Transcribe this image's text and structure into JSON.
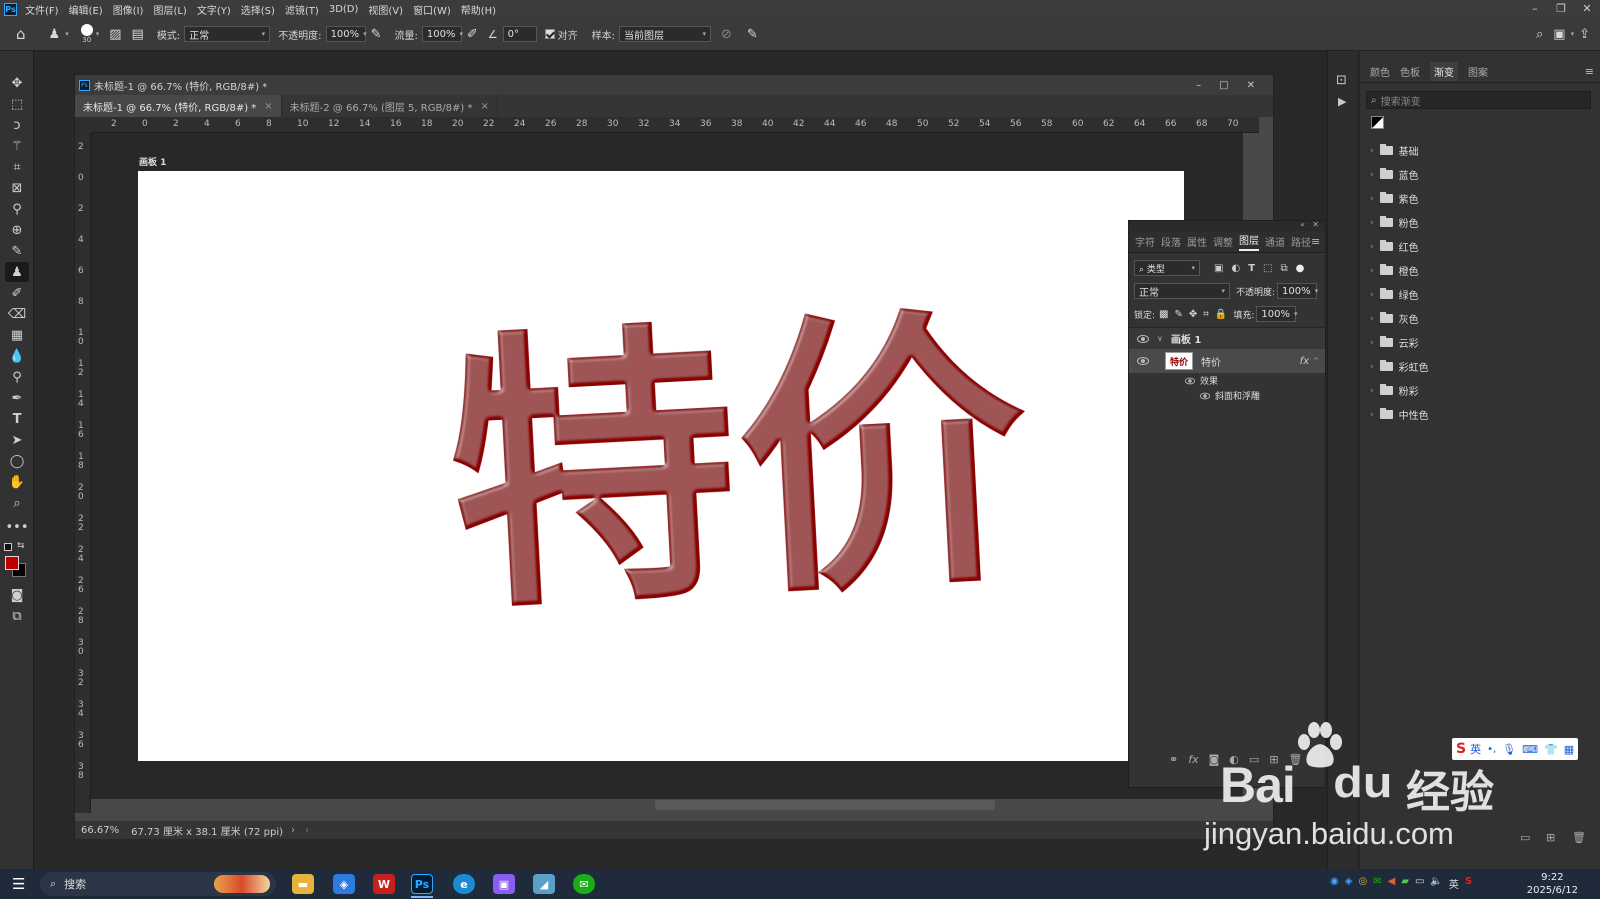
{
  "app": {
    "logo": "Ps"
  },
  "menu": [
    "文件(F)",
    "编辑(E)",
    "图像(I)",
    "图层(L)",
    "文字(Y)",
    "选择(S)",
    "滤镜(T)",
    "3D(D)",
    "视图(V)",
    "窗口(W)",
    "帮助(H)"
  ],
  "options": {
    "brush_size": "30",
    "mode_label": "模式:",
    "mode_value": "正常",
    "opacity_label": "不透明度:",
    "opacity_value": "100%",
    "flow_label": "流量:",
    "flow_value": "100%",
    "angle_value": "0°",
    "align_label": "对齐",
    "sample_label": "样本:",
    "sample_value": "当前图层"
  },
  "document": {
    "window_title": "未标题-1 @ 66.7% (特价, RGB/8#) *",
    "tabs": [
      {
        "label": "未标题-1 @ 66.7% (特价, RGB/8#) *",
        "active": true
      },
      {
        "label": "未标题-2 @ 66.7% (图层 5, RGB/8#) *",
        "active": false
      }
    ],
    "h_ruler": [
      "2",
      "0",
      "2",
      "4",
      "6",
      "8",
      "10",
      "12",
      "14",
      "16",
      "18",
      "20",
      "22",
      "24",
      "26",
      "28",
      "30",
      "32",
      "34",
      "36",
      "38",
      "40",
      "42",
      "44",
      "46",
      "48",
      "50",
      "52",
      "54",
      "56",
      "58",
      "60",
      "62",
      "64",
      "66",
      "68",
      "70"
    ],
    "v_ruler": [
      "2",
      "0",
      "2",
      "4",
      "6",
      "8",
      "10",
      "12",
      "14",
      "16",
      "18",
      "20",
      "22",
      "24",
      "26",
      "28",
      "30",
      "32",
      "34",
      "36",
      "38"
    ],
    "artboard_label": "画板 1",
    "canvas_text": "特价",
    "text_color": "#8b0000",
    "status_zoom": "66.67%",
    "status_size": "67.73 厘米 x 38.1 厘米 (72 ppi)"
  },
  "layers_panel": {
    "tabs": [
      "字符",
      "段落",
      "属性",
      "调整",
      "图层",
      "通道",
      "路径"
    ],
    "active_tab": "图层",
    "filter_label": "类型",
    "blend_mode": "正常",
    "opacity_label": "不透明度:",
    "opacity_value": "100%",
    "lock_label": "锁定:",
    "fill_label": "填充:",
    "fill_value": "100%",
    "group_name": "画板 1",
    "layer_name": "特价",
    "fx_label": "fx",
    "effects_label": "效果",
    "effect_name": "斜面和浮雕"
  },
  "right_panel": {
    "tabs": [
      "颜色",
      "色板",
      "渐变",
      "图案"
    ],
    "active_tab": "渐变",
    "search_placeholder": "搜索渐变",
    "folders": [
      "基础",
      "蓝色",
      "紫色",
      "粉色",
      "红色",
      "橙色",
      "绿色",
      "灰色",
      "云彩",
      "彩虹色",
      "粉彩",
      "中性色"
    ]
  },
  "taskbar": {
    "search_label": "搜索",
    "time": "9:22",
    "date": "2025/6/12",
    "ime_label": "英"
  },
  "watermark": {
    "brand": "Bai",
    "brand2": "经验",
    "url": "jingyan.baidu.com"
  },
  "ime_bar": {
    "label": "英"
  },
  "colors": {
    "foreground": "#c00000",
    "background": "#000000",
    "accent": "#31a8ff"
  }
}
